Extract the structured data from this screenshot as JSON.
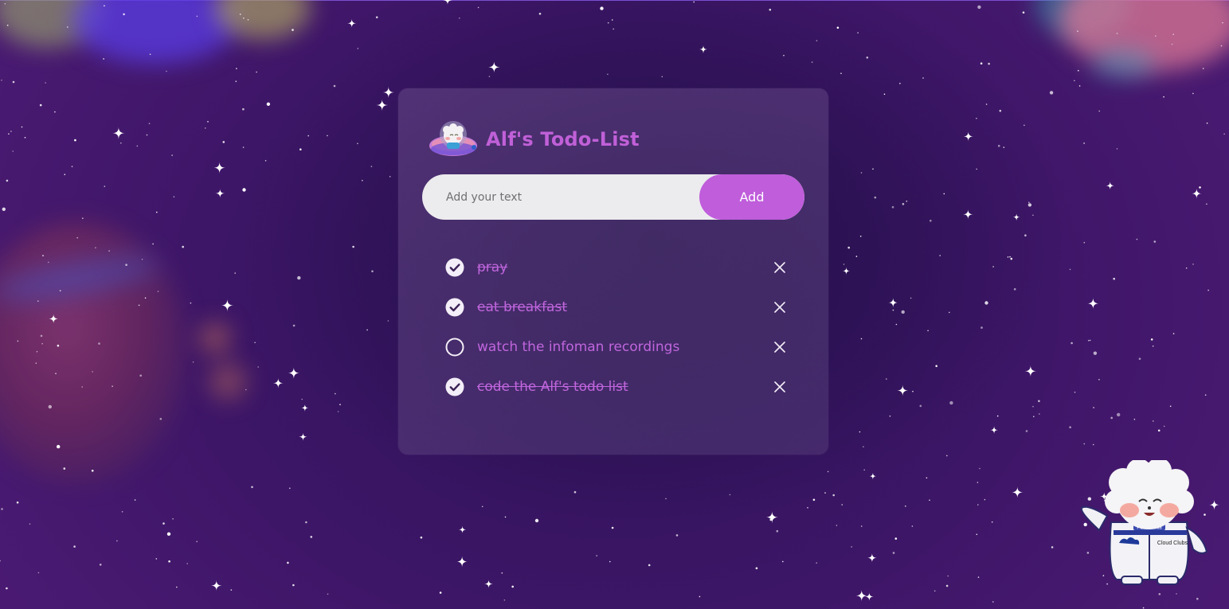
{
  "app": {
    "title": "Alf's Todo-List",
    "accent_color": "#bf5ddb",
    "logo_icon": "alf-spaceship-icon"
  },
  "input": {
    "placeholder": "Add your text",
    "value": ""
  },
  "add_button": {
    "label": "Add"
  },
  "todos": [
    {
      "text": "pray",
      "done": true
    },
    {
      "text": "eat breakfast",
      "done": true
    },
    {
      "text": "watch the infoman recordings",
      "done": false
    },
    {
      "text": "code the Alf's todo list",
      "done": true
    }
  ],
  "icons": {
    "checked": "check-circle-icon",
    "unchecked": "empty-circle-icon",
    "remove": "close-icon"
  },
  "mascot": {
    "name": "alf-astronaut-mascot",
    "badge_text": "PSP Manila",
    "suit_text": "Cloud Clubs"
  }
}
